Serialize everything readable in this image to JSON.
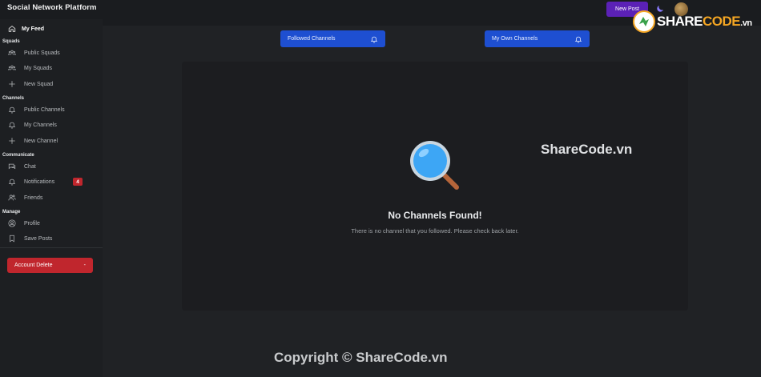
{
  "app": {
    "title": "Social Network Platform",
    "new_post_label": "New Post"
  },
  "sidebar": {
    "feed": {
      "label": "My Feed",
      "icon": "home-icon"
    },
    "sections": {
      "squads": "Squads",
      "channels": "Channels",
      "communicate": "Communicate",
      "manage": "Manage"
    },
    "items": {
      "public_squads": {
        "label": "Public Squads",
        "icon": "squads-icon"
      },
      "my_squads": {
        "label": "My Squads",
        "icon": "squads-icon"
      },
      "new_squad": {
        "label": "New Squad",
        "icon": "plus-icon"
      },
      "public_channels": {
        "label": "Public Channels",
        "icon": "bell-icon"
      },
      "my_channels": {
        "label": "My Channels",
        "icon": "bell-icon"
      },
      "new_channel": {
        "label": "New Channel",
        "icon": "plus-icon"
      },
      "chat": {
        "label": "Chat",
        "icon": "chat-icon"
      },
      "notifications": {
        "label": "Notifications",
        "icon": "bell-icon",
        "badge": "4"
      },
      "friends": {
        "label": "Friends",
        "icon": "friends-icon"
      },
      "profile": {
        "label": "Profile",
        "icon": "profile-icon"
      },
      "save_posts": {
        "label": "Save Posts",
        "icon": "bookmark-icon"
      }
    },
    "account_delete": {
      "label": "Account Delete",
      "suffix": "-"
    }
  },
  "main": {
    "tabs": [
      {
        "label": "Followed Channels",
        "icon": "bell-icon"
      },
      {
        "label": "My Own Channels",
        "icon": "bell-icon"
      }
    ],
    "empty_state": {
      "icon": "magnifier-icon",
      "title": "No Channels Found!",
      "message": "There is no channel that you followed. Please check back later."
    }
  },
  "watermarks": {
    "logo_prefix": "SHARE",
    "logo_suffix": "CODE",
    "logo_domain": ".vn",
    "center": "ShareCode.vn",
    "copyright": "Copyright © ShareCode.vn"
  },
  "colors": {
    "accent_blue": "#1e4fd1",
    "accent_purple": "#5b21b6",
    "danger": "#c0262d",
    "background": "#1a1c1f"
  }
}
